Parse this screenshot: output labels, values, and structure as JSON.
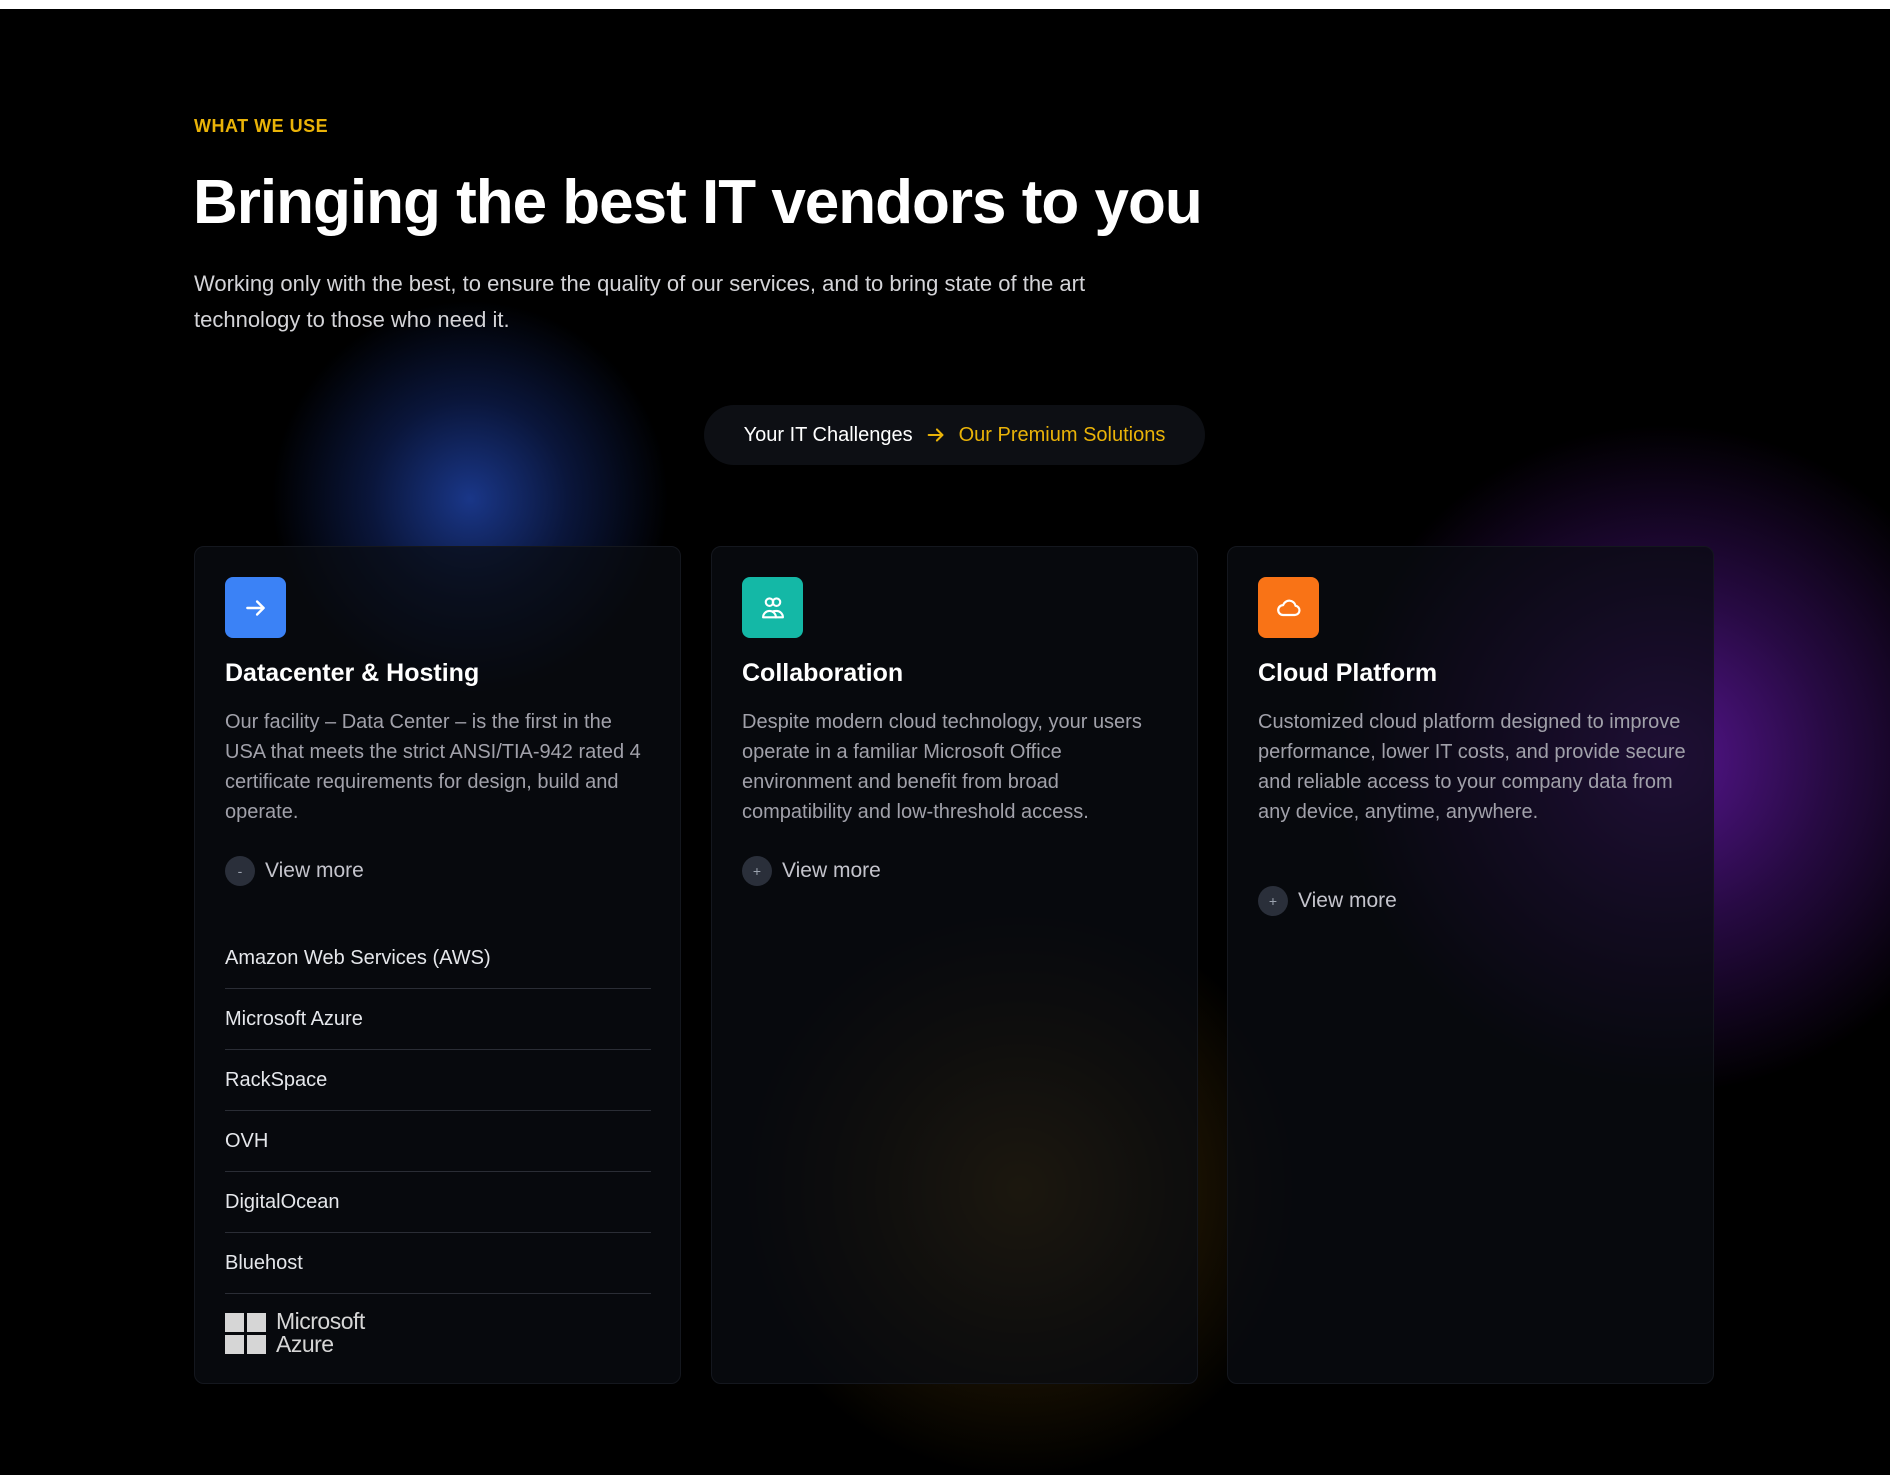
{
  "section": {
    "eyebrow": "WHAT WE USE",
    "title": "Bringing the best IT vendors to you",
    "subtitle": "Working only with the best, to ensure the quality of our services, and to bring state of the art technology to those who need it."
  },
  "toggle": {
    "left_label": "Your IT Challenges",
    "arrow_icon": "arrow-right-icon",
    "right_label": "Our Premium Solutions"
  },
  "colors": {
    "accent": "#eab308",
    "blue": "#3b82f6",
    "teal": "#14b8a6",
    "orange": "#f97316"
  },
  "cards": [
    {
      "icon": "arrow-right-icon",
      "title": "Datacenter & Hosting",
      "description": "Our facility – Data Center – is the first in the USA that meets the strict ANSI/TIA-942 rated 4 certificate requirements for design, build and operate.",
      "toggle_symbol": "-",
      "view_more": "View more",
      "vendors": [
        "Amazon Web Services (AWS)",
        "Microsoft Azure",
        "RackSpace",
        "OVH",
        "DigitalOcean",
        "Bluehost"
      ],
      "logo": {
        "line1": "Microsoft",
        "line2": "Azure"
      }
    },
    {
      "icon": "users-icon",
      "title": "Collaboration",
      "description": "Despite modern cloud technology, your users operate in a familiar Microsoft Office environment and benefit from broad compatibility and low-threshold access.",
      "toggle_symbol": "+",
      "view_more": "View more"
    },
    {
      "icon": "cloud-icon",
      "title": "Cloud Platform",
      "description": "Customized cloud platform designed to improve performance, lower IT costs, and provide secure and reliable access to your company data from any device, anytime, anywhere.",
      "toggle_symbol": "+",
      "view_more": "View more"
    }
  ]
}
